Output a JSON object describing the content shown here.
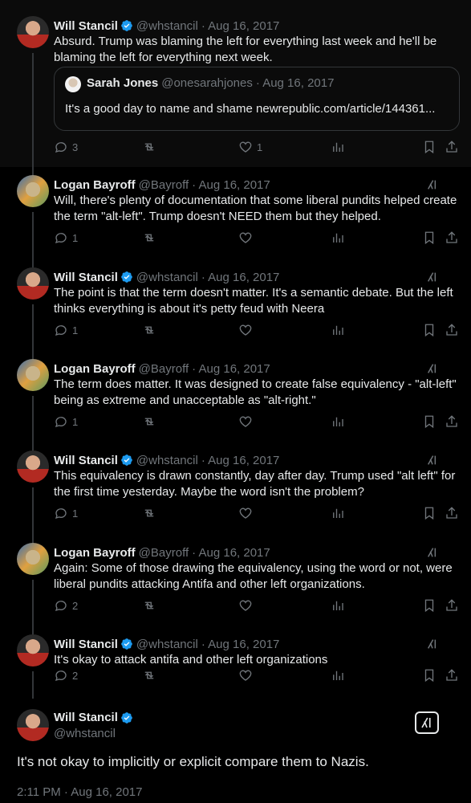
{
  "colors": {
    "background": "#000000",
    "text": "#e7e9ea",
    "muted": "#71767b",
    "verified": "#1d9bf0",
    "border": "#333639"
  },
  "replies": [
    {
      "name": "Will Stancil",
      "handle": "@whstancil",
      "date": "· Aug 16, 2017",
      "avatar": "will-avatar",
      "text": "Absurd. Trump was blaming the left for everything last week and he'll be blaming the left for everything next week.",
      "reply_count": "3",
      "like_count": "1",
      "grok": false,
      "quote": {
        "name": "Sarah Jones",
        "handle": "@onesarahjones",
        "date": "· Aug 16, 2017",
        "text": "It's a good day to name and shame newrepublic.com/article/144361..."
      }
    },
    {
      "name": "Logan Bayroff",
      "handle": "@Bayroff",
      "date": "· Aug 16, 2017",
      "avatar": "logan-avatar",
      "text": "Will, there's plenty of documentation that some liberal pundits helped create the term \"alt-left\". Trump doesn't NEED them but they helped.",
      "reply_count": "1",
      "like_count": "",
      "grok": true
    },
    {
      "name": "Will Stancil",
      "handle": "@whstancil",
      "date": "· Aug 16, 2017",
      "avatar": "will-avatar",
      "text": "The point is that the term doesn't matter. It's a semantic debate. But the left thinks everything is about it's petty feud with Neera",
      "reply_count": "1",
      "like_count": "",
      "grok": true
    },
    {
      "name": "Logan Bayroff",
      "handle": "@Bayroff",
      "date": "· Aug 16, 2017",
      "avatar": "logan-avatar",
      "text": "The term does matter. It was designed to create false equivalency - \"alt-left\" being as extreme and unacceptable as \"alt-right.\"",
      "reply_count": "1",
      "like_count": "",
      "grok": true
    },
    {
      "name": "Will Stancil",
      "handle": "@whstancil",
      "date": "· Aug 16, 2017",
      "avatar": "will-avatar",
      "text": "This equivalency is drawn constantly, day after day. Trump used \"alt left\" for the first time yesterday. Maybe the word isn't the problem?",
      "reply_count": "1",
      "like_count": "",
      "grok": true
    },
    {
      "name": "Logan Bayroff",
      "handle": "@Bayroff",
      "date": "· Aug 16, 2017",
      "avatar": "logan-avatar",
      "text": "Again: Some of those drawing the equivalency, using the word or not, were liberal pundits attacking Antifa and other left organizations.",
      "reply_count": "2",
      "like_count": "",
      "grok": true
    },
    {
      "name": "Will Stancil",
      "handle": "@whstancil",
      "date": "· Aug 16, 2017",
      "avatar": "will-avatar",
      "text": "It's okay to attack antifa and other left organizations",
      "reply_count": "2",
      "like_count": "",
      "grok": true
    }
  ],
  "main_tweet": {
    "name": "Will Stancil",
    "handle": "@whstancil",
    "text": "It's not okay to implicitly or explicit compare them to Nazis.",
    "timestamp": "2:11 PM · Aug 16, 2017"
  }
}
